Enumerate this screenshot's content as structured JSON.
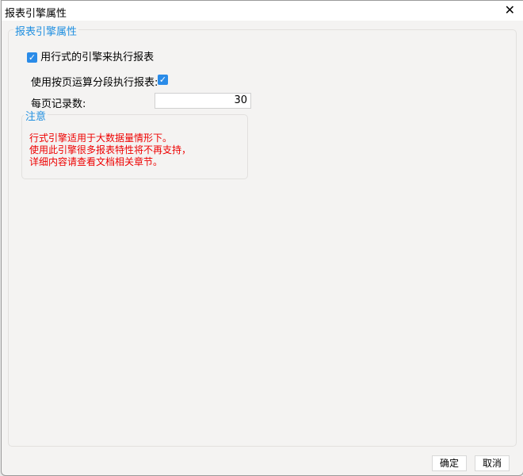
{
  "window": {
    "title": "报表引擎属性",
    "close_icon": "close-icon"
  },
  "group": {
    "legend": "报表引擎属性",
    "use_row_engine": {
      "label": "用行式的引擎来执行报表",
      "checked": true
    },
    "paged_exec": {
      "label": "使用按页运算分段执行报表:",
      "checked": true
    },
    "records_per_page": {
      "label": "每页记录数:",
      "value": "30"
    },
    "note": {
      "legend": "注意",
      "lines": [
        "行式引擎适用于大数据量情形下。",
        "使用此引擎很多报表特性将不再支持，",
        "详细内容请查看文档相关章节。"
      ]
    }
  },
  "buttons": {
    "ok": "确定",
    "cancel": "取消"
  }
}
